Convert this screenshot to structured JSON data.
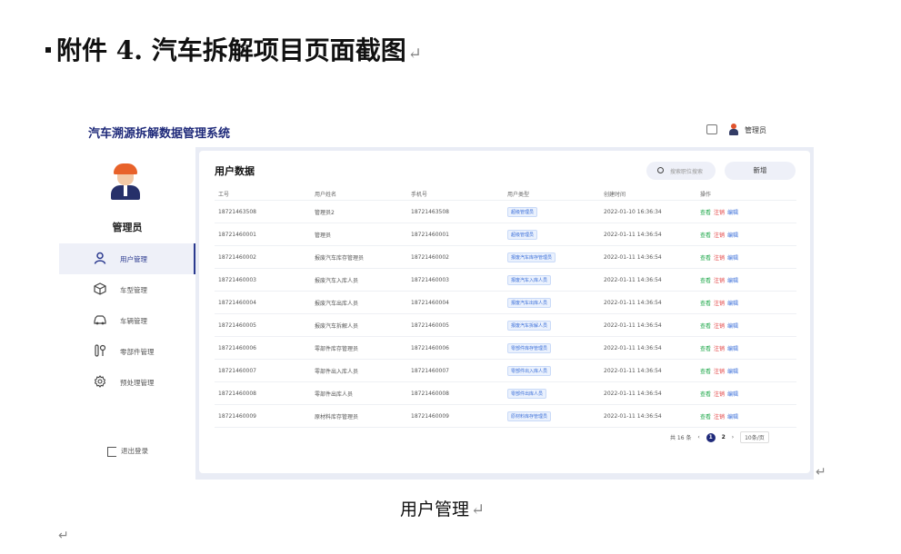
{
  "document": {
    "heading": "附件 4. 汽车拆解项目页面截图",
    "paragraph_mark": "↵",
    "caption": "用户管理"
  },
  "app": {
    "title": "汽车溯源拆解数据管理系统",
    "header": {
      "user_name": "管理员",
      "icons": [
        "message-icon",
        "user-icon"
      ]
    },
    "sidebar": {
      "role_name": "管理员",
      "menu": [
        {
          "label": "用户管理",
          "icon": "user-icon",
          "active": true
        },
        {
          "label": "车型管理",
          "icon": "cube-icon",
          "active": false
        },
        {
          "label": "车辆管理",
          "icon": "car-icon",
          "active": false
        },
        {
          "label": "零部件管理",
          "icon": "wrench-icon",
          "active": false
        },
        {
          "label": "预处理管理",
          "icon": "gear-icon",
          "active": false
        }
      ],
      "logout_label": "退出登录"
    },
    "main": {
      "title": "用户数据",
      "search_placeholder": "搜索职位搜索",
      "add_button": "新增",
      "table": {
        "columns": [
          "工号",
          "用户姓名",
          "手机号",
          "用户类型",
          "创建时间",
          "操作"
        ],
        "rows": [
          {
            "id": "18721463508",
            "name": "管理员2",
            "phone": "18721463508",
            "type": "超级管理员",
            "created": "2022-01-10 16:36:34"
          },
          {
            "id": "18721460001",
            "name": "管理员",
            "phone": "18721460001",
            "type": "超级管理员",
            "created": "2022-01-11 14:36:54"
          },
          {
            "id": "18721460002",
            "name": "报废汽车库存管理员",
            "phone": "18721460002",
            "type": "报废汽车库存管理员",
            "created": "2022-01-11 14:36:54"
          },
          {
            "id": "18721460003",
            "name": "报废汽车入库人员",
            "phone": "18721460003",
            "type": "报废汽车入库人员",
            "created": "2022-01-11 14:36:54"
          },
          {
            "id": "18721460004",
            "name": "报废汽车出库人员",
            "phone": "18721460004",
            "type": "报废汽车出库人员",
            "created": "2022-01-11 14:36:54"
          },
          {
            "id": "18721460005",
            "name": "报废汽车拆解人员",
            "phone": "18721460005",
            "type": "报废汽车拆解人员",
            "created": "2022-01-11 14:36:54"
          },
          {
            "id": "18721460006",
            "name": "零部件库存管理员",
            "phone": "18721460006",
            "type": "零部件库存管理员",
            "created": "2022-01-11 14:36:54"
          },
          {
            "id": "18721460007",
            "name": "零部件出入库人员",
            "phone": "18721460007",
            "type": "零部件出入库人员",
            "created": "2022-01-11 14:36:54"
          },
          {
            "id": "18721460008",
            "name": "零部件出库人员",
            "phone": "18721460008",
            "type": "零部件出库人员",
            "created": "2022-01-11 14:36:54"
          },
          {
            "id": "18721460009",
            "name": "原材料库存管理员",
            "phone": "18721460009",
            "type": "原材料库存管理员",
            "created": "2022-01-11 14:36:54"
          }
        ],
        "actions": {
          "view": "查看",
          "delete": "注销",
          "edit": "编辑"
        }
      },
      "pagination": {
        "total": "共 16 条",
        "pages": [
          "1",
          "2"
        ],
        "current": "1",
        "page_size": "10条/页",
        "prev": "‹",
        "next": "›"
      }
    }
  }
}
